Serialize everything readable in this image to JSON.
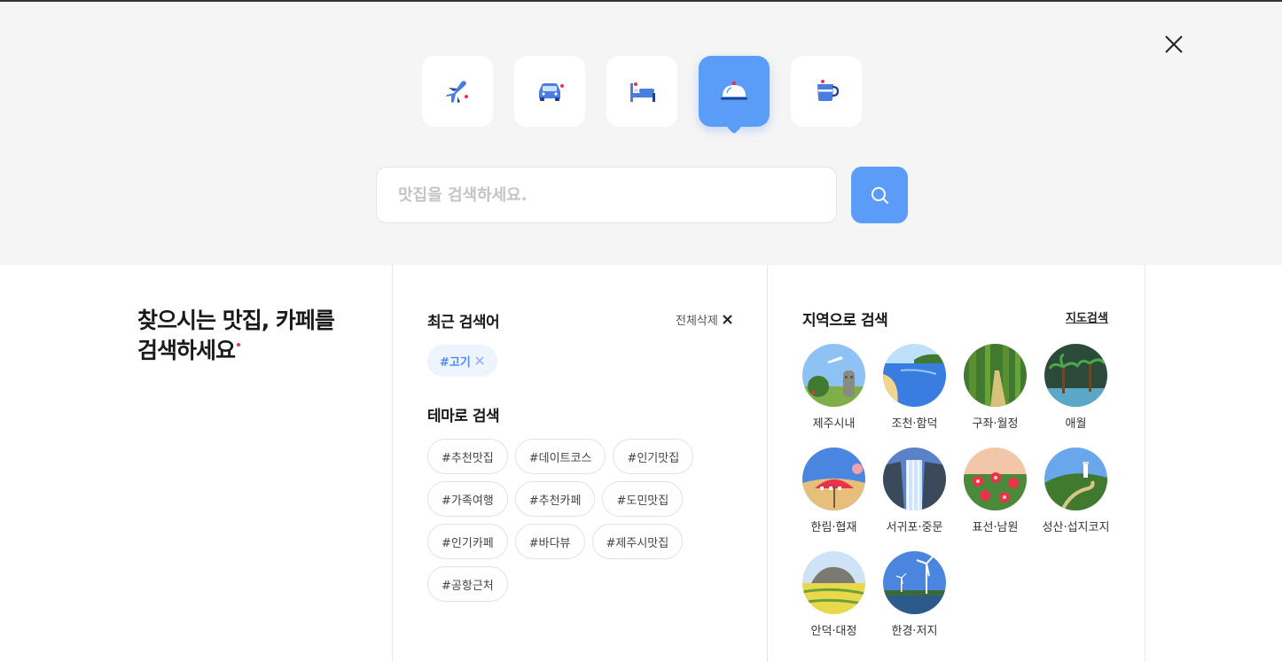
{
  "header": {
    "close_icon": "close-icon",
    "categories": [
      {
        "icon": "airplane-icon",
        "active": false
      },
      {
        "icon": "car-icon",
        "active": false
      },
      {
        "icon": "bed-icon",
        "active": false
      },
      {
        "icon": "cloche-icon",
        "active": true
      },
      {
        "icon": "coffee-cup-icon",
        "active": false
      }
    ],
    "search": {
      "placeholder": "맛집을 검색하세요.",
      "value": "",
      "button_icon": "search-icon"
    }
  },
  "headline": {
    "line1": "찾으시는 맛집, 카페를",
    "line2": "검색하세요"
  },
  "recent": {
    "title": "최근 검색어",
    "clear_label": "전체삭제",
    "tags": [
      "#고기"
    ]
  },
  "theme": {
    "title": "테마로 검색",
    "tags": [
      "#추천맛집",
      "#데이트코스",
      "#인기맛집",
      "#가족여행",
      "#추천카페",
      "#도민맛집",
      "#인기카페",
      "#바다뷰",
      "#제주시맛집",
      "#공항근처"
    ]
  },
  "region": {
    "title": "지역으로 검색",
    "map_link": "지도검색",
    "items": [
      "제주시내",
      "조천·함덕",
      "구좌·월정",
      "애월",
      "한림·협재",
      "서귀포·중문",
      "표선·남원",
      "성산·섭지코지",
      "안덕·대정",
      "한경·저지"
    ]
  },
  "colors": {
    "accent": "#5b9cf8",
    "point": "#e8334a",
    "bg_top": "#f5f5f5"
  }
}
